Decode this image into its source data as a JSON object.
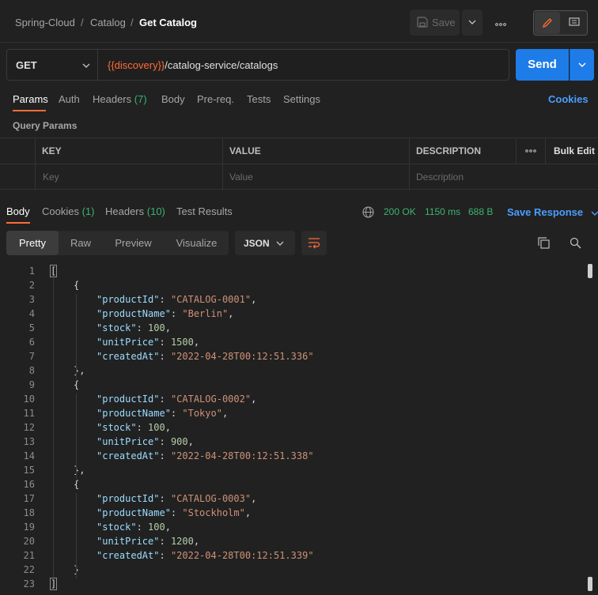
{
  "breadcrumb": [
    "Spring-Cloud",
    "Catalog",
    "Get Catalog"
  ],
  "toolbar": {
    "save_label": "Save"
  },
  "request": {
    "method": "GET",
    "url_variable": "{{discovery}}",
    "url_path": "/catalog-service/catalogs",
    "send_label": "Send"
  },
  "request_tabs": {
    "params": "Params",
    "auth": "Auth",
    "headers": "Headers",
    "headers_count": "(7)",
    "body": "Body",
    "prereq": "Pre-req.",
    "tests": "Tests",
    "settings": "Settings",
    "cookies": "Cookies"
  },
  "query_params": {
    "title": "Query Params",
    "columns": [
      "KEY",
      "VALUE",
      "DESCRIPTION"
    ],
    "bulk_edit": "Bulk Edit",
    "placeholders": [
      "Key",
      "Value",
      "Description"
    ]
  },
  "response_tabs": {
    "body": "Body",
    "cookies": "Cookies",
    "cookies_count": "(1)",
    "headers": "Headers",
    "headers_count": "(10)",
    "test_results": "Test Results"
  },
  "response_status": {
    "status": "200 OK",
    "time": "1150 ms",
    "size": "688 B",
    "save": "Save Response"
  },
  "view_tabs": [
    "Pretty",
    "Raw",
    "Preview",
    "Visualize"
  ],
  "format": "JSON",
  "code_lines": [
    {
      "n": "1",
      "indent": 0,
      "tokens": [
        {
          "t": "[",
          "c": "p"
        }
      ]
    },
    {
      "n": "2",
      "indent": 1,
      "tokens": [
        {
          "t": "{",
          "c": "p"
        }
      ]
    },
    {
      "n": "3",
      "indent": 2,
      "tokens": [
        {
          "t": "\"productId\"",
          "c": "k"
        },
        {
          "t": ": ",
          "c": "p"
        },
        {
          "t": "\"CATALOG-0001\"",
          "c": "s"
        },
        {
          "t": ",",
          "c": "p"
        }
      ]
    },
    {
      "n": "4",
      "indent": 2,
      "tokens": [
        {
          "t": "\"productName\"",
          "c": "k"
        },
        {
          "t": ": ",
          "c": "p"
        },
        {
          "t": "\"Berlin\"",
          "c": "s"
        },
        {
          "t": ",",
          "c": "p"
        }
      ]
    },
    {
      "n": "5",
      "indent": 2,
      "tokens": [
        {
          "t": "\"stock\"",
          "c": "k"
        },
        {
          "t": ": ",
          "c": "p"
        },
        {
          "t": "100",
          "c": "n"
        },
        {
          "t": ",",
          "c": "p"
        }
      ]
    },
    {
      "n": "6",
      "indent": 2,
      "tokens": [
        {
          "t": "\"unitPrice\"",
          "c": "k"
        },
        {
          "t": ": ",
          "c": "p"
        },
        {
          "t": "1500",
          "c": "n"
        },
        {
          "t": ",",
          "c": "p"
        }
      ]
    },
    {
      "n": "7",
      "indent": 2,
      "tokens": [
        {
          "t": "\"createdAt\"",
          "c": "k"
        },
        {
          "t": ": ",
          "c": "p"
        },
        {
          "t": "\"2022-04-28T00:12:51.336\"",
          "c": "s"
        }
      ]
    },
    {
      "n": "8",
      "indent": 1,
      "tokens": [
        {
          "t": "},",
          "c": "p"
        }
      ]
    },
    {
      "n": "9",
      "indent": 1,
      "tokens": [
        {
          "t": "{",
          "c": "p"
        }
      ]
    },
    {
      "n": "10",
      "indent": 2,
      "tokens": [
        {
          "t": "\"productId\"",
          "c": "k"
        },
        {
          "t": ": ",
          "c": "p"
        },
        {
          "t": "\"CATALOG-0002\"",
          "c": "s"
        },
        {
          "t": ",",
          "c": "p"
        }
      ]
    },
    {
      "n": "11",
      "indent": 2,
      "tokens": [
        {
          "t": "\"productName\"",
          "c": "k"
        },
        {
          "t": ": ",
          "c": "p"
        },
        {
          "t": "\"Tokyo\"",
          "c": "s"
        },
        {
          "t": ",",
          "c": "p"
        }
      ]
    },
    {
      "n": "12",
      "indent": 2,
      "tokens": [
        {
          "t": "\"stock\"",
          "c": "k"
        },
        {
          "t": ": ",
          "c": "p"
        },
        {
          "t": "100",
          "c": "n"
        },
        {
          "t": ",",
          "c": "p"
        }
      ]
    },
    {
      "n": "13",
      "indent": 2,
      "tokens": [
        {
          "t": "\"unitPrice\"",
          "c": "k"
        },
        {
          "t": ": ",
          "c": "p"
        },
        {
          "t": "900",
          "c": "n"
        },
        {
          "t": ",",
          "c": "p"
        }
      ]
    },
    {
      "n": "14",
      "indent": 2,
      "tokens": [
        {
          "t": "\"createdAt\"",
          "c": "k"
        },
        {
          "t": ": ",
          "c": "p"
        },
        {
          "t": "\"2022-04-28T00:12:51.338\"",
          "c": "s"
        }
      ]
    },
    {
      "n": "15",
      "indent": 1,
      "tokens": [
        {
          "t": "},",
          "c": "p"
        }
      ]
    },
    {
      "n": "16",
      "indent": 1,
      "tokens": [
        {
          "t": "{",
          "c": "p"
        }
      ]
    },
    {
      "n": "17",
      "indent": 2,
      "tokens": [
        {
          "t": "\"productId\"",
          "c": "k"
        },
        {
          "t": ": ",
          "c": "p"
        },
        {
          "t": "\"CATALOG-0003\"",
          "c": "s"
        },
        {
          "t": ",",
          "c": "p"
        }
      ]
    },
    {
      "n": "18",
      "indent": 2,
      "tokens": [
        {
          "t": "\"productName\"",
          "c": "k"
        },
        {
          "t": ": ",
          "c": "p"
        },
        {
          "t": "\"Stockholm\"",
          "c": "s"
        },
        {
          "t": ",",
          "c": "p"
        }
      ]
    },
    {
      "n": "19",
      "indent": 2,
      "tokens": [
        {
          "t": "\"stock\"",
          "c": "k"
        },
        {
          "t": ": ",
          "c": "p"
        },
        {
          "t": "100",
          "c": "n"
        },
        {
          "t": ",",
          "c": "p"
        }
      ]
    },
    {
      "n": "20",
      "indent": 2,
      "tokens": [
        {
          "t": "\"unitPrice\"",
          "c": "k"
        },
        {
          "t": ": ",
          "c": "p"
        },
        {
          "t": "1200",
          "c": "n"
        },
        {
          "t": ",",
          "c": "p"
        }
      ]
    },
    {
      "n": "21",
      "indent": 2,
      "tokens": [
        {
          "t": "\"createdAt\"",
          "c": "k"
        },
        {
          "t": ": ",
          "c": "p"
        },
        {
          "t": "\"2022-04-28T00:12:51.339\"",
          "c": "s"
        }
      ]
    },
    {
      "n": "22",
      "indent": 1,
      "tokens": [
        {
          "t": "}",
          "c": "p"
        }
      ]
    },
    {
      "n": "23",
      "indent": 0,
      "tokens": [
        {
          "t": "]",
          "c": "p"
        }
      ]
    }
  ],
  "colors": {
    "accent": "#ff6c37",
    "primary": "#1e7ce8",
    "link": "#4a9eff",
    "success": "#3cb371"
  },
  "icons": [
    "save-icon",
    "chevron-down-icon",
    "more-icon",
    "pencil-icon",
    "comment-icon",
    "globe-icon",
    "wrap-lines-icon",
    "copy-icon",
    "search-icon"
  ]
}
